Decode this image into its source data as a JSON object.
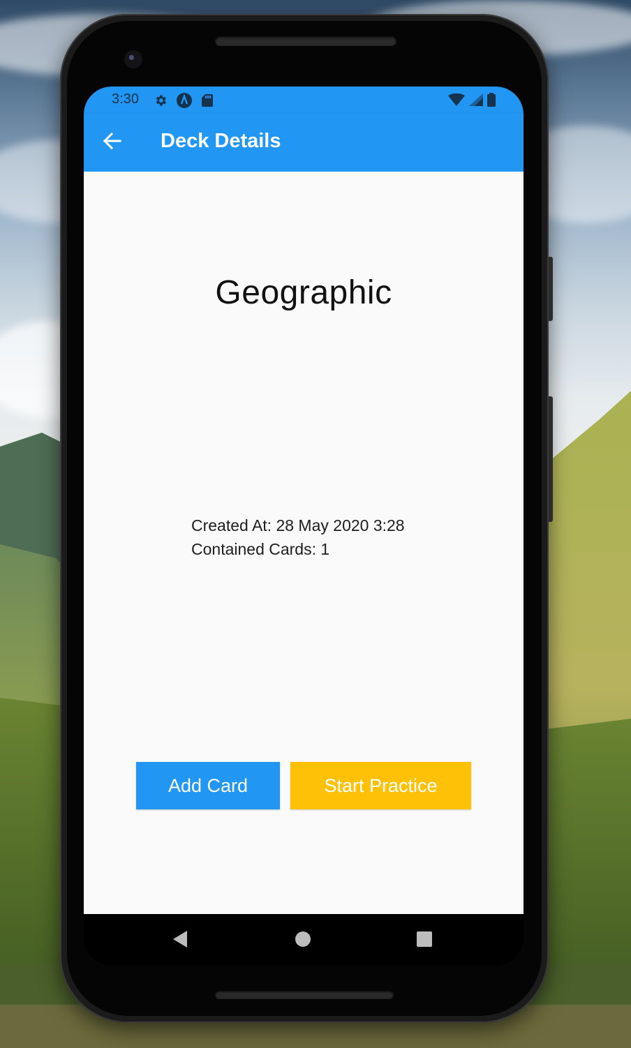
{
  "status_bar": {
    "time": "3:30",
    "left_icons": [
      "settings-icon",
      "android-studio-icon",
      "sd-card-icon"
    ],
    "right_icons": [
      "wifi-icon",
      "signal-icon",
      "battery-icon"
    ]
  },
  "app_bar": {
    "title": "Deck Details",
    "back_icon": "arrow-left-icon",
    "color": "#2196f3"
  },
  "deck": {
    "name": "Geographic",
    "created_at": "Created At: 28 May 2020 3:28",
    "contained_cards": "Contained Cards: 1"
  },
  "actions": {
    "add_card_label": "Add Card",
    "add_card_color": "#2196f3",
    "start_practice_label": "Start Practice",
    "start_practice_color": "#ffc107"
  },
  "nav_bar": {
    "icons": [
      "back-triangle-icon",
      "home-circle-icon",
      "recents-square-icon"
    ]
  }
}
